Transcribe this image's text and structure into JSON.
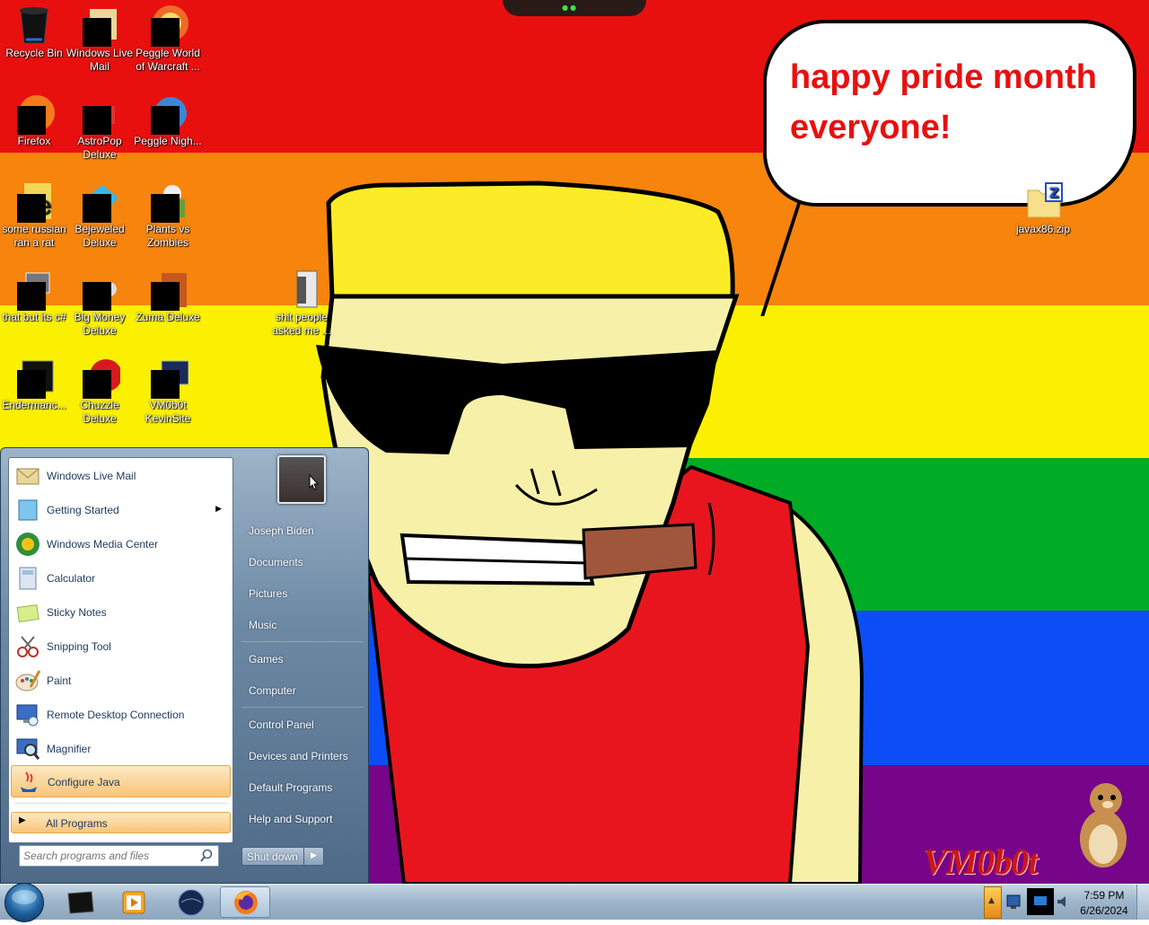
{
  "desktop": {
    "speech_bubble": "happy pride month everyone!",
    "watermark": "VM0b0t",
    "icons": [
      {
        "label": "Recycle Bin",
        "icon": "recycle-bin-icon"
      },
      {
        "label": "Windows Live Mail",
        "icon": "windows-live-mail-icon"
      },
      {
        "label": "Peggle World of Warcraft ...",
        "icon": "peggle-wow-icon"
      },
      {
        "label": "Firefox",
        "icon": "firefox-icon"
      },
      {
        "label": "AstroPop Deluxe",
        "icon": "astropop-icon"
      },
      {
        "label": "Peggle Nigh...",
        "icon": "peggle-nights-icon"
      },
      {
        "label": "some russian ran a rat",
        "icon": "ie-icon"
      },
      {
        "label": "Bejeweled Deluxe",
        "icon": "bejeweled-icon"
      },
      {
        "label": "Plants vs Zombies",
        "icon": "plants-vs-zombies-icon"
      },
      {
        "label": "that but its c#",
        "icon": "window-stack-icon"
      },
      {
        "label": "Big Money Deluxe",
        "icon": "big-money-icon"
      },
      {
        "label": "Zuma Deluxe",
        "icon": "zuma-icon"
      },
      {
        "label": "shit people asked me ...",
        "icon": "folder-icon"
      },
      {
        "label": "Endermanc...",
        "icon": "console-icon"
      },
      {
        "label": "Chuzzle Deluxe",
        "icon": "chuzzle-icon"
      },
      {
        "label": "VM0b0t KevinSite",
        "icon": "monitor-icon"
      },
      {
        "label": "javax86.zip",
        "icon": "zip-icon"
      }
    ]
  },
  "start_menu": {
    "programs": [
      {
        "label": "Windows Live Mail",
        "icon": "mail-icon",
        "has_submenu": false
      },
      {
        "label": "Getting Started",
        "icon": "getting-started-icon",
        "has_submenu": true
      },
      {
        "label": "Windows Media Center",
        "icon": "media-center-icon",
        "has_submenu": false
      },
      {
        "label": "Calculator",
        "icon": "calculator-icon",
        "has_submenu": false
      },
      {
        "label": "Sticky Notes",
        "icon": "sticky-notes-icon",
        "has_submenu": false
      },
      {
        "label": "Snipping Tool",
        "icon": "scissors-icon",
        "has_submenu": false
      },
      {
        "label": "Paint",
        "icon": "paint-icon",
        "has_submenu": false
      },
      {
        "label": "Remote Desktop Connection",
        "icon": "remote-desktop-icon",
        "has_submenu": false
      },
      {
        "label": "Magnifier",
        "icon": "magnifier-icon",
        "has_submenu": false
      },
      {
        "label": "Configure Java",
        "icon": "java-icon",
        "has_submenu": false
      }
    ],
    "all_programs": "All Programs",
    "search_placeholder": "Search programs and files",
    "right_links": [
      {
        "label": "Joseph Biden"
      },
      {
        "label": "Documents"
      },
      {
        "label": "Pictures"
      },
      {
        "label": "Music"
      },
      {
        "label": "Games"
      },
      {
        "label": "Computer"
      },
      {
        "label": "Control Panel"
      },
      {
        "label": "Devices and Printers"
      },
      {
        "label": "Default Programs"
      },
      {
        "label": "Help and Support"
      }
    ],
    "shutdown": "Shut down"
  },
  "taskbar": {
    "buttons": [
      {
        "icon": "black-box-icon"
      },
      {
        "icon": "media-player-icon"
      },
      {
        "icon": "globe-icon"
      },
      {
        "icon": "firefox-icon"
      }
    ],
    "time": "7:59 PM",
    "date": "6/26/2024"
  },
  "colors": {
    "accent": "#f9c577",
    "bubble_text": "#e81010",
    "watermark": "#c91818"
  }
}
